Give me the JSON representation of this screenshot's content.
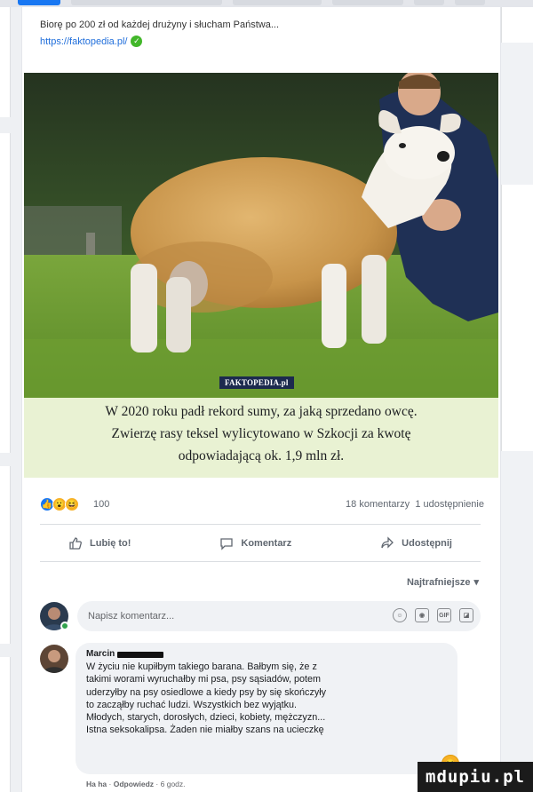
{
  "post": {
    "caption": "Biorę po 200 zł od każdej drużyny i słucham Państwa...",
    "link": "https://faktopedia.pl/",
    "photo": {
      "watermark": "FAKTOPEDIA.pl"
    },
    "headline_lines": [
      "W 2020 roku padł rekord sumy, za jaką sprzedano owcę.",
      "Zwierzę rasy teksel wylicytowano w Szkocji za kwotę",
      "odpowiadającą ok. 1,9 mln zł."
    ],
    "reaction_count": "100",
    "comments_count": "18 komentarzy",
    "shares_count": "1 udostępnienie",
    "actions": {
      "like": "Lubię to!",
      "comment": "Komentarz",
      "share": "Udostępnij"
    },
    "sort_label": "Najtrafniejsze",
    "compose": {
      "placeholder": "Napisz komentarz..."
    },
    "comment": {
      "author": "Marcin",
      "lines": [
        "W życiu nie kupiłbym takiego barana. Bałbym się, że z",
        "takimi worami wyruchałby mi psa, psy sąsiadów, potem",
        "uderzyłby na psy osiedlowe a kiedy psy by się skończyły",
        "to zacząłby ruchać ludzi. Wszystkich bez wyjątku.",
        "Młodych, starych, dorosłych, dzieci, kobiety, mężczyzn...",
        "Istna seksokalipsa. Żaden nie miałby szans na ucieczkę"
      ],
      "meta_haha": "Ha ha",
      "meta_reply": "Odpowiedz",
      "meta_time": "6 godz."
    }
  },
  "brand": "mdupiu.pl",
  "colors": {
    "accent": "#1877f2",
    "headline_bg": "#e9f2d3",
    "online": "#31a24c"
  }
}
